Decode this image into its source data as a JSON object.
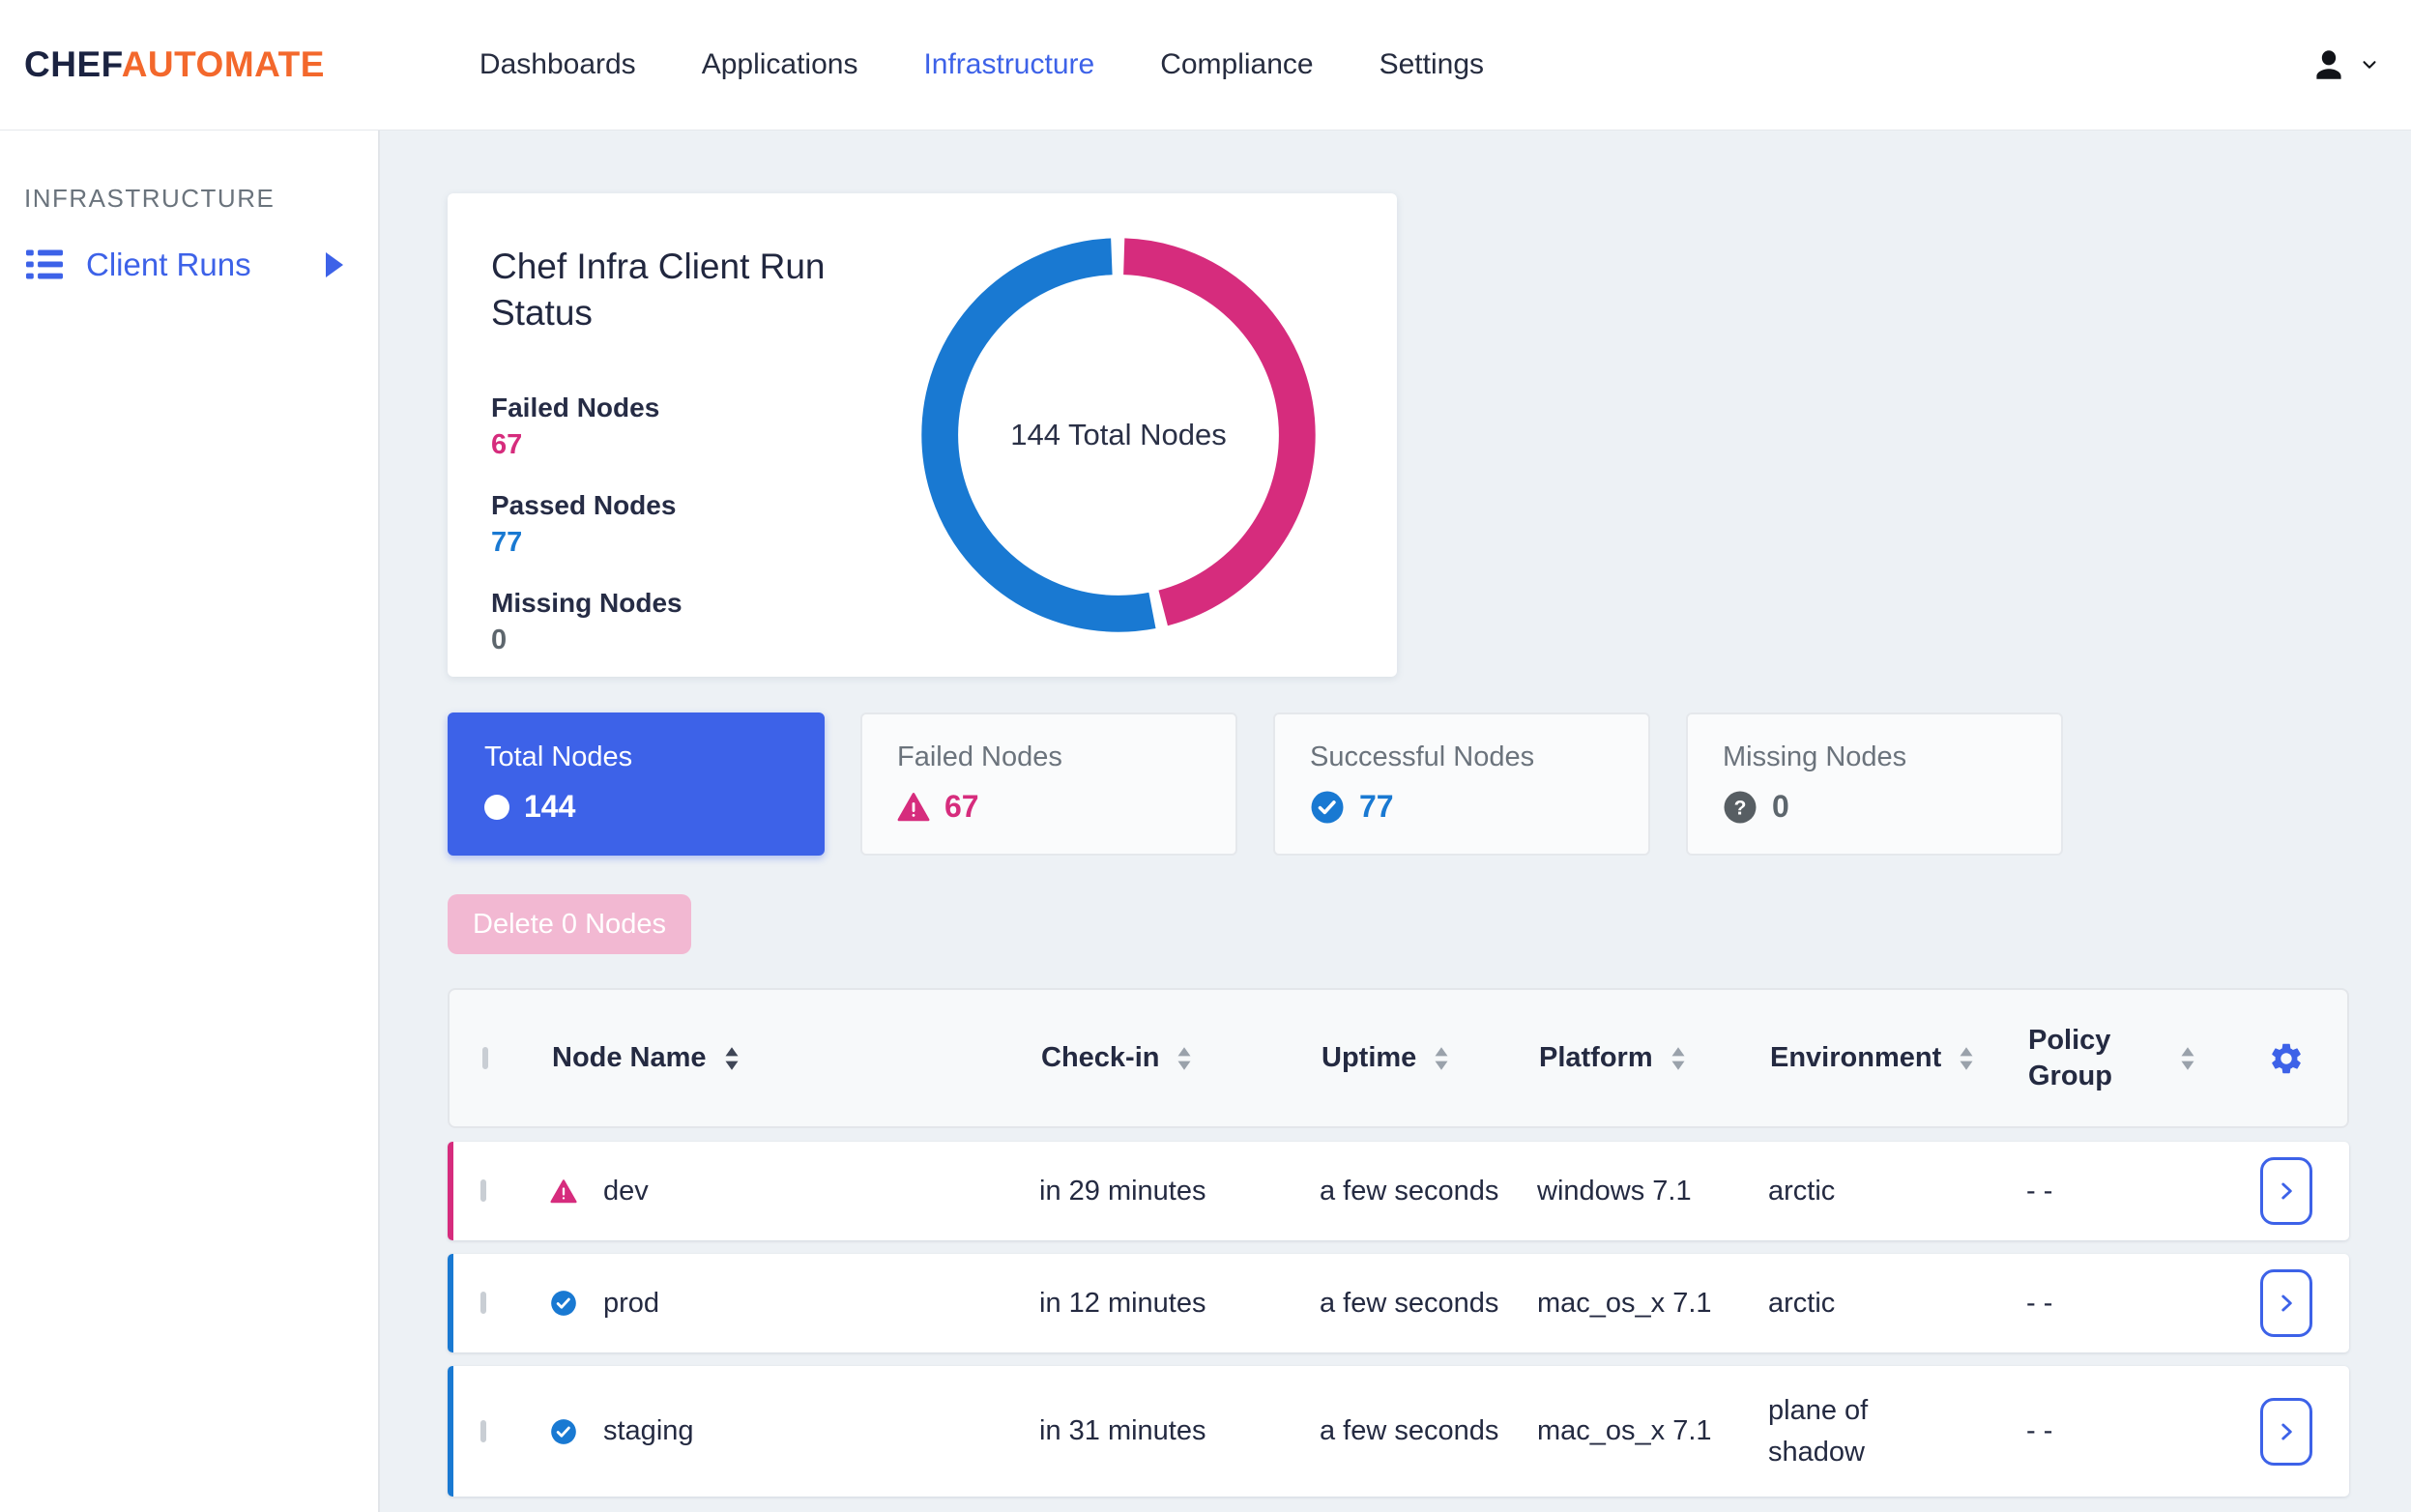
{
  "brand": {
    "chef": "CHEF",
    "automate": "AUTOMATE"
  },
  "nav": {
    "items": [
      {
        "label": "Dashboards",
        "active": false
      },
      {
        "label": "Applications",
        "active": false
      },
      {
        "label": "Infrastructure",
        "active": true
      },
      {
        "label": "Compliance",
        "active": false
      },
      {
        "label": "Settings",
        "active": false
      }
    ]
  },
  "sidebar": {
    "heading": "INFRASTRUCTURE",
    "items": [
      {
        "label": "Client Runs",
        "icon": "client-runs-list-icon",
        "expanded": false
      }
    ]
  },
  "status_card": {
    "title": "Chef Infra Client Run Status",
    "stats": [
      {
        "label": "Failed Nodes",
        "value": 67
      },
      {
        "label": "Passed Nodes",
        "value": 77
      },
      {
        "label": "Missing Nodes",
        "value": 0
      }
    ]
  },
  "chart_data": {
    "type": "pie",
    "donut": true,
    "title": "Chef Infra Client Run Status",
    "center_label": "144 Total Nodes",
    "total": 144,
    "start_angle": "top",
    "direction": "clockwise",
    "series": [
      {
        "name": "Failed Nodes",
        "value": 67,
        "color": "#d62c7d"
      },
      {
        "name": "Passed Nodes",
        "value": 77,
        "color": "#1979d2"
      },
      {
        "name": "Missing Nodes",
        "value": 0,
        "color": "#5d666d"
      }
    ]
  },
  "summary_cards": [
    {
      "label": "Total Nodes",
      "value": "144",
      "icon": "circle-icon",
      "selected": true
    },
    {
      "label": "Failed Nodes",
      "value": "67",
      "icon": "warning-triangle-icon",
      "selected": false
    },
    {
      "label": "Successful Nodes",
      "value": "77",
      "icon": "check-circle-icon",
      "selected": false
    },
    {
      "label": "Missing Nodes",
      "value": "0",
      "icon": "question-circle-icon",
      "selected": false
    }
  ],
  "delete_button": {
    "label": "Delete 0 Nodes"
  },
  "table": {
    "columns": [
      {
        "label": "Node Name",
        "sortable": true,
        "sort_active": true
      },
      {
        "label": "Check-in",
        "sortable": true,
        "sort_active": false
      },
      {
        "label": "Uptime",
        "sortable": true,
        "sort_active": false
      },
      {
        "label": "Platform",
        "sortable": true,
        "sort_active": false
      },
      {
        "label": "Environment",
        "sortable": true,
        "sort_active": false
      },
      {
        "label": "Policy Group",
        "sortable": true,
        "sort_active": false
      }
    ],
    "rows": [
      {
        "status": "failed",
        "name": "dev",
        "check_in": "in 29 minutes",
        "uptime": "a few seconds",
        "platform": "windows 7.1",
        "environment": "arctic",
        "policy_group": "- -"
      },
      {
        "status": "success",
        "name": "prod",
        "check_in": "in 12 minutes",
        "uptime": "a few seconds",
        "platform": "mac_os_x 7.1",
        "environment": "arctic",
        "policy_group": "- -"
      },
      {
        "status": "success",
        "name": "staging",
        "check_in": "in 31 minutes",
        "uptime": "a few seconds",
        "platform": "mac_os_x 7.1",
        "environment": "plane of shadow",
        "policy_group": "- -"
      }
    ]
  },
  "colors": {
    "primary_blue": "#3d62e8",
    "success_blue": "#1979d2",
    "failure_pink": "#d62c7d",
    "delete_pink": "#f2b8d2",
    "brand_orange": "#f3682c",
    "brand_navy": "#1b2341",
    "page_background": "#edf1f5"
  }
}
